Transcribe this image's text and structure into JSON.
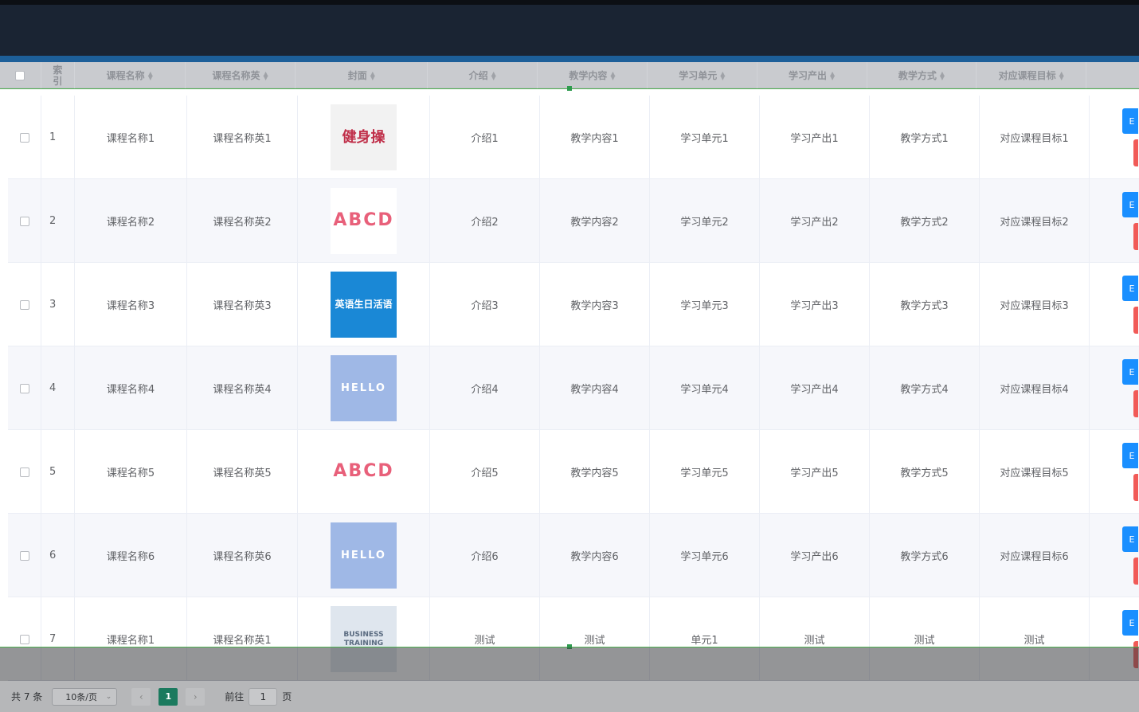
{
  "table": {
    "headers": {
      "index": "索\n引",
      "name": "课程名称",
      "name_en": "课程名称英",
      "cover": "封面",
      "intro": "介绍",
      "content": "教学内容",
      "unit": "学习单元",
      "output": "学习产出",
      "method": "教学方式",
      "goal": "对应课程目标"
    },
    "sort_icon": "sort-caret-icon",
    "rows": [
      {
        "index": "1",
        "name": "课程名称1",
        "name_en": "课程名称英1",
        "cover": "健身操",
        "intro": "介绍1",
        "content": "教学内容1",
        "unit": "学习单元1",
        "output": "学习产出1",
        "method": "教学方式1",
        "goal": "对应课程目标1"
      },
      {
        "index": "2",
        "name": "课程名称2",
        "name_en": "课程名称英2",
        "cover": "ABCD",
        "intro": "介绍2",
        "content": "教学内容2",
        "unit": "学习单元2",
        "output": "学习产出2",
        "method": "教学方式2",
        "goal": "对应课程目标2"
      },
      {
        "index": "3",
        "name": "课程名称3",
        "name_en": "课程名称英3",
        "cover": "英语生日活语",
        "intro": "介绍3",
        "content": "教学内容3",
        "unit": "学习单元3",
        "output": "学习产出3",
        "method": "教学方式3",
        "goal": "对应课程目标3"
      },
      {
        "index": "4",
        "name": "课程名称4",
        "name_en": "课程名称英4",
        "cover": "HELLO",
        "intro": "介绍4",
        "content": "教学内容4",
        "unit": "学习单元4",
        "output": "学习产出4",
        "method": "教学方式4",
        "goal": "对应课程目标4"
      },
      {
        "index": "5",
        "name": "课程名称5",
        "name_en": "课程名称英5",
        "cover": "ABCD",
        "intro": "介绍5",
        "content": "教学内容5",
        "unit": "学习单元5",
        "output": "学习产出5",
        "method": "教学方式5",
        "goal": "对应课程目标5"
      },
      {
        "index": "6",
        "name": "课程名称6",
        "name_en": "课程名称英6",
        "cover": "HELLO",
        "intro": "介绍6",
        "content": "教学内容6",
        "unit": "学习单元6",
        "output": "学习产出6",
        "method": "教学方式6",
        "goal": "对应课程目标6"
      },
      {
        "index": "7",
        "name": "课程名称1",
        "name_en": "课程名称英1",
        "cover": "BUSINESS TRAINING",
        "intro": "测试",
        "content": "测试",
        "unit": "单元1",
        "output": "测试",
        "method": "测试",
        "goal": "测试"
      }
    ],
    "edit_label": "E"
  },
  "pagination": {
    "total": "共 7 条",
    "page_size": "10条/页",
    "prev": "‹",
    "current": "1",
    "next": "›",
    "goto_label": "前往",
    "goto_value": "1",
    "page_suffix": "页"
  },
  "colors": {
    "topbar": "#1a2433",
    "accent": "#1d5f99",
    "edit_button": "#1a8fff",
    "delete_button": "#f15a57",
    "active_page": "#1b7a5e"
  }
}
